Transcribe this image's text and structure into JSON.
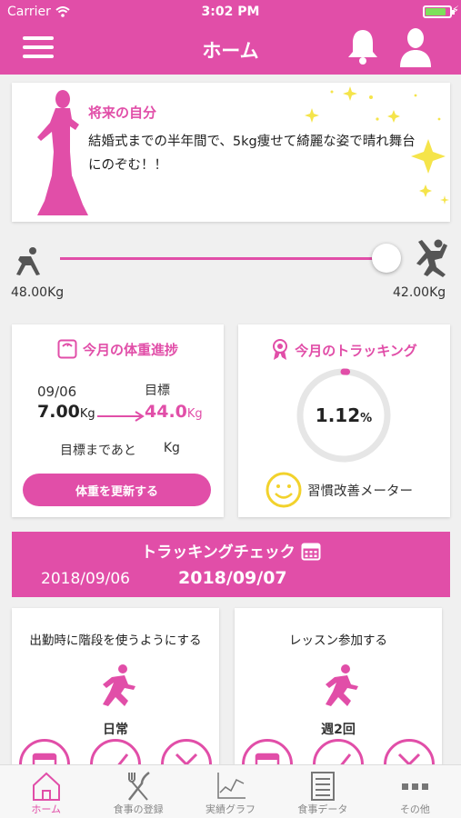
{
  "status_bar": {
    "carrier": "Carrier",
    "time": "3:02 PM"
  },
  "header": {
    "title": "ホーム"
  },
  "goal": {
    "title": "将来の自分",
    "text": "結婚式までの半年間で、5kg痩せて綺麗な姿で晴れ舞台にのぞむ！！"
  },
  "progress": {
    "start_weight": "48.00Kg",
    "goal_weight": "42.00Kg",
    "fraction": 1.0
  },
  "weight_card": {
    "title": "今月の体重進捗",
    "date": "09/06",
    "current_value": "7.00",
    "current_unit": "Kg",
    "target_label": "目標",
    "target_value": "44.0",
    "target_unit": "Kg",
    "remaining_label": "目標まであと",
    "remaining_unit": "Kg",
    "button": "体重を更新する"
  },
  "tracking_card": {
    "title": "今月のトラッキング",
    "percent_value": "1.12",
    "percent_unit": "%",
    "percent": 1.12,
    "habit_label": "習慣改善メーター"
  },
  "tracking_check": {
    "title": "トラッキングチェック",
    "prev_date": "2018/09/06",
    "current_date": "2018/09/07"
  },
  "tasks": [
    {
      "name": "出勤時に階段を使うようにする",
      "frequency": "日常"
    },
    {
      "name": "レッスン参加する",
      "frequency": "週2回"
    }
  ],
  "tabs": [
    {
      "label": "ホーム",
      "icon": "home-icon",
      "active": true
    },
    {
      "label": "食事の登録",
      "icon": "fork-knife-icon",
      "active": false
    },
    {
      "label": "実績グラフ",
      "icon": "line-chart-icon",
      "active": false
    },
    {
      "label": "食事データ",
      "icon": "list-document-icon",
      "active": false
    },
    {
      "label": "その他",
      "icon": "more-dots-icon",
      "active": false
    }
  ],
  "colors": {
    "accent": "#e14ea8",
    "smile": "#f2d22c",
    "sparkle": "#f5e44a"
  }
}
